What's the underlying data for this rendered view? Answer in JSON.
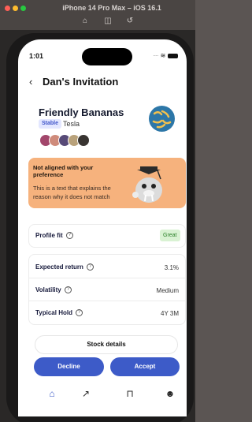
{
  "simulator": {
    "title": "iPhone 14 Pro Max – iOS 16.1",
    "tools": [
      "home-icon",
      "screenshot-icon",
      "rotate-icon"
    ]
  },
  "status_bar": {
    "time": "1:01"
  },
  "header": {
    "title": "Dan's Invitation"
  },
  "stock": {
    "name": "Friendly Bananas",
    "badge": "Stable",
    "ticker": "Tesla",
    "logo_color": "#2d77a8"
  },
  "warning": {
    "title_line1": "Not aligned with your",
    "title_line2": "preference",
    "text": "This is a text that explains the reason why it does not match",
    "color": "#f6b27d"
  },
  "profile_fit": {
    "label": "Profile fit",
    "value": "Great"
  },
  "metrics": [
    {
      "label": "Expected return",
      "value": "3.1%"
    },
    {
      "label": "Volatility",
      "value": "Medium"
    },
    {
      "label": "Typical Hold",
      "value": "4Y 3M"
    }
  ],
  "actions": {
    "details": "Stock details",
    "decline": "Decline",
    "accept": "Accept",
    "accent": "#3d5bc8"
  },
  "tabs": [
    "home-icon",
    "trend-icon",
    "book-icon",
    "people-icon"
  ]
}
